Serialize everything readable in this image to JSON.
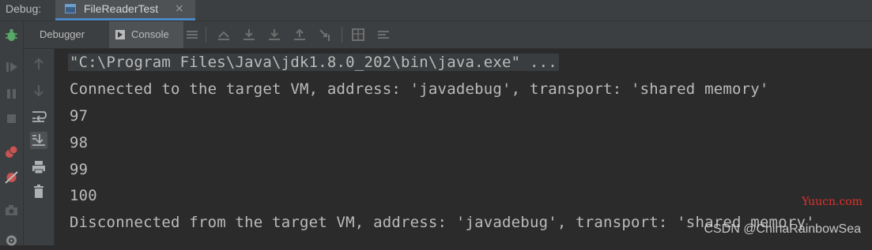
{
  "topbar": {
    "debug_label": "Debug:",
    "run_tab_label": "FileReaderTest",
    "close_glyph": "×"
  },
  "subtabs": {
    "debugger_label": "Debugger",
    "console_label": "Console"
  },
  "console": {
    "lines": [
      "\"C:\\Program Files\\Java\\jdk1.8.0_202\\bin\\java.exe\" ...",
      "Connected to the target VM, address: 'javadebug', transport: 'shared memory'",
      "97",
      "98",
      "99",
      "100",
      "Disconnected from the target VM, address: 'javadebug', transport: 'shared memory'"
    ]
  },
  "watermarks": {
    "site": "Yuucn.com",
    "author": "CSDN @ChinaRainbowSea"
  },
  "colors": {
    "accent": "#4a88c7",
    "background": "#2b2b2b",
    "panel": "#3c3f41",
    "watermark_red": "#e0312c"
  }
}
